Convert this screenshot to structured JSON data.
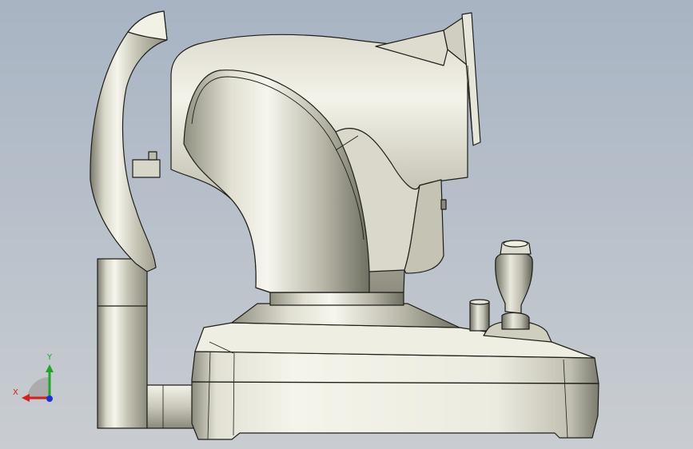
{
  "triad": {
    "x_label": "X",
    "y_label": "Y",
    "x_color": "#d42020",
    "y_color": "#1fa62a",
    "z_color": "#1f2fd8"
  },
  "colors": {
    "bg_top": "#a9b5c3",
    "bg_bottom": "#c8ccd0",
    "metal_light": "#f4f3e9",
    "metal_mid": "#bfbeb0",
    "metal_dark": "#6e6e62",
    "edge": "#1e1e1a"
  },
  "model": {
    "description_icon": "ophthalmic-instrument-model"
  }
}
